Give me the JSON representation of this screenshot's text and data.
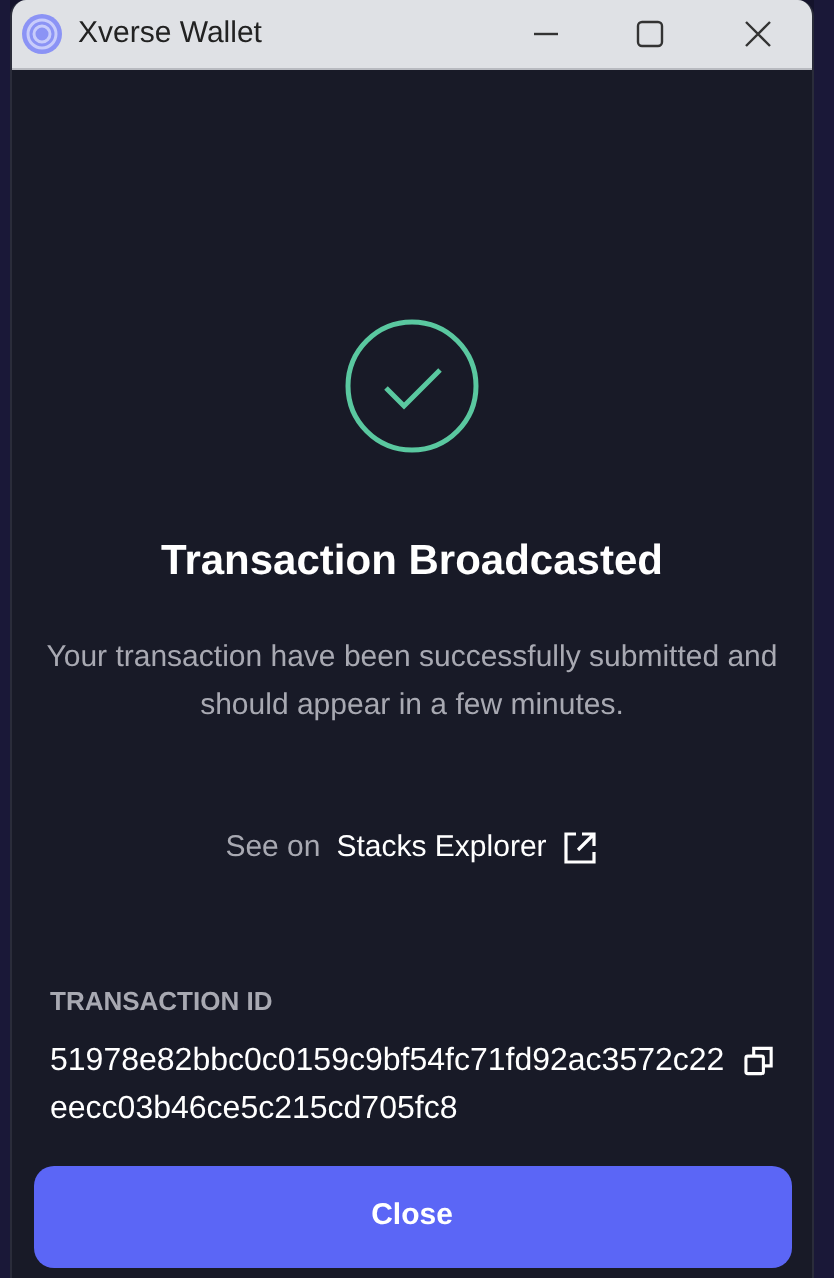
{
  "window": {
    "title": "Xverse Wallet"
  },
  "status": {
    "kind": "success",
    "title": "Transaction Broadcasted",
    "message": "Your transaction have been successfully submitted and should appear in a few minutes."
  },
  "explorer": {
    "prefix": "See on",
    "link": "Stacks Explorer"
  },
  "transaction": {
    "label": "TRANSACTION ID",
    "id": "51978e82bbc0c0159c9bf54fc71fd92ac3572c22eecc03b46ce5c215cd705fc8"
  },
  "buttons": [
    "Close"
  ]
}
